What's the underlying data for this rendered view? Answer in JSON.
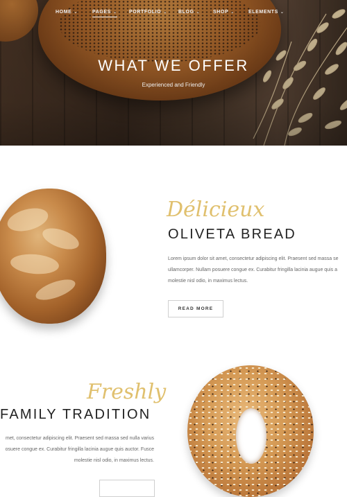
{
  "nav": {
    "items": [
      {
        "label": "HOME",
        "active": false
      },
      {
        "label": "PAGES",
        "active": true
      },
      {
        "label": "PORTFOLIO",
        "active": false
      },
      {
        "label": "BLOG",
        "active": false
      },
      {
        "label": "SHOP",
        "active": false
      },
      {
        "label": "ELEMENTS",
        "active": false
      }
    ],
    "chevron": "⌄"
  },
  "hero": {
    "title": "WHAT WE OFFER",
    "subtitle": "Experienced and Friendly"
  },
  "section1": {
    "script": "Délicieux",
    "heading": "OLIVETA BREAD",
    "paragraph_lines": [
      "Lorem ipsum dolor sit amet, consectetur adipiscing elit. Praesent sed massa se",
      "ullamcorper. Nullam posuere congue ex. Curabitur fringilla lacinia augue quis a",
      "molestie nisl odio, in maximus lectus."
    ],
    "button": "READ MORE"
  },
  "section2": {
    "script": "Freshly",
    "heading": "FAMILY TRADITION",
    "paragraph_lines": [
      "met, consectetur adipiscing elit. Praesent sed massa sed nulla varius",
      "osuere congue ex. Curabitur fringilla lacinia augue quis auctor. Fusce",
      "molestie nisl odio, in maximus lectus."
    ]
  },
  "colors": {
    "accent_script": "#e0c06e",
    "heading": "#222222",
    "body_text": "#666666"
  }
}
